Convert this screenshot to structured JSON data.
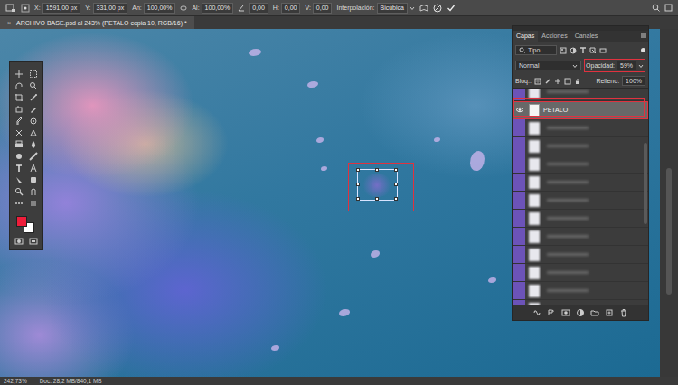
{
  "options_bar": {
    "fields": [
      {
        "label": "X:",
        "value": "1591,00 px",
        "kind": "plain"
      },
      {
        "label": "Y:",
        "value": "331,00 px",
        "kind": "plain"
      },
      {
        "label": "An:",
        "value": "100,00%",
        "kind": "plain"
      },
      {
        "label": "Al:",
        "value": "100,00%",
        "kind": "plain"
      },
      {
        "label": "",
        "value": "0,00",
        "kind": "angle"
      },
      {
        "label": "H:",
        "value": "0,00",
        "kind": "plain"
      },
      {
        "label": "V:",
        "value": "0,00",
        "kind": "plain"
      }
    ],
    "interpolation": {
      "label": "Interpolación:",
      "value": "Bicúbica"
    }
  },
  "document_tab": {
    "title": "ARCHIVO BASE.psd al 243% (PETALO copia 10, RGB/16) *",
    "close": "×"
  },
  "toolbar": {
    "colors": [
      {
        "name": "foreground",
        "color": "#ee1d3a"
      },
      {
        "name": "background",
        "color": "#ffffff"
      }
    ]
  },
  "layers_panel": {
    "tabs": [
      {
        "label": "Capas",
        "selected": true
      },
      {
        "label": "Acciones",
        "selected": false
      },
      {
        "label": "Canales",
        "selected": false
      }
    ],
    "filter": "Tipo",
    "blend_mode": "Normal",
    "opacity": {
      "label": "Opacidad:",
      "value": "59%"
    },
    "lock": {
      "label": "Bloq.:"
    },
    "fill": {
      "label": "Relleno:",
      "value": "100%"
    },
    "layers": [
      {
        "name": "",
        "visible": false,
        "selected": false
      },
      {
        "name": "PETALO",
        "visible": true,
        "selected": true
      },
      {
        "name": "",
        "visible": false,
        "selected": false
      },
      {
        "name": "",
        "visible": false,
        "selected": false
      },
      {
        "name": "",
        "visible": false,
        "selected": false
      },
      {
        "name": "",
        "visible": false,
        "selected": false
      },
      {
        "name": "",
        "visible": false,
        "selected": false
      },
      {
        "name": "",
        "visible": false,
        "selected": false
      },
      {
        "name": "",
        "visible": false,
        "selected": false
      },
      {
        "name": "",
        "visible": false,
        "selected": false
      },
      {
        "name": "",
        "visible": false,
        "selected": false
      },
      {
        "name": "",
        "visible": false,
        "selected": false
      },
      {
        "name": "",
        "visible": false,
        "selected": false
      }
    ]
  },
  "status_bar": {
    "zoom": "242,73%",
    "doc": "Doc: 28,2 MB/840,1 MB"
  }
}
